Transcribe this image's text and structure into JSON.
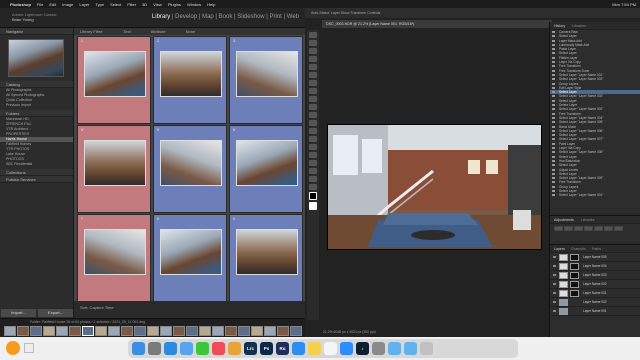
{
  "menubar": {
    "app": "Photoshop",
    "items": [
      "File",
      "Edit",
      "Image",
      "Layer",
      "Type",
      "Select",
      "Filter",
      "3D",
      "View",
      "Plugins",
      "Window",
      "Help"
    ],
    "clock": "Mon 7:54 PM"
  },
  "lightroom": {
    "identity_line1": "Adobe Lightroom Classic",
    "identity_line2": "Brian Young",
    "modules": [
      "Library",
      "Develop",
      "Map",
      "Book",
      "Slideshow",
      "Print",
      "Web"
    ],
    "active_module": "Library",
    "left_panels": {
      "navigator": "Navigator",
      "catalog": "Catalog",
      "catalog_items": [
        "All Photographs",
        "All Synced Photographs",
        "Quick Collection",
        "Previous Import"
      ],
      "folders": "Folders",
      "folder_items": [
        "Macintosh HD",
        "ZFRENCH PILL",
        "YTR Architect...",
        "PROPERTIES",
        "Harris House",
        "Fairfield Homes",
        "YTR PHOTOS",
        "Lake House",
        "PHOTOGS",
        "ABC Residential"
      ],
      "collections": "Collections",
      "publish": "Publish Services"
    },
    "buttons": [
      "Import...",
      "Export..."
    ],
    "grid_header": [
      "Library Filter:",
      "Text",
      "Attribute",
      "None"
    ],
    "cells": [
      {
        "num": "1",
        "tint": "#c37a7e"
      },
      {
        "num": "2",
        "tint": "#6d7fb8"
      },
      {
        "num": "3",
        "tint": "#6d7fb8"
      },
      {
        "num": "4",
        "tint": "#c37a7e"
      },
      {
        "num": "5",
        "tint": "#6d7fb8"
      },
      {
        "num": "6",
        "tint": "#6d7fb8"
      },
      {
        "num": "7",
        "tint": "#c37a7e"
      },
      {
        "num": "8",
        "tint": "#6d7fb8"
      },
      {
        "num": "9",
        "tint": "#6d7fb8"
      }
    ],
    "toolbar_text": "Sort: Capture Time",
    "filmstrip_info": "Folder: Fairfield House   26 of 64 photos / 1 selected / 2021_05_11 001.dng"
  },
  "photoshop": {
    "options_bar": "Auto-Select: Layer   Show Transform Controls",
    "doc_tab": "DSC_0003.HDR @ 21.2% (Layer Name 001, RGB/16*)",
    "status": "21.2%   6048 px x 4024 px (300 ppi)",
    "history_tabs": [
      "History",
      "Libraries"
    ],
    "history_rows": [
      "Camera Raw",
      "Select Layer",
      "Layer Mask Add",
      "Luminosity Mask Add",
      "Paste Layer",
      "Select Layer",
      "Flatten Layer",
      "Layer Via Copy",
      "Free Transform",
      "Free Transform Done",
      "Select Layer \"Layer Name 001\"",
      "Select Layer \"Layer Name 002\"",
      "Group Layers",
      "Edit Layer Style",
      "Select Layer",
      "Select Layer \"Layer Name 003\"",
      "Select Layer",
      "Delete Layer",
      "Select Layer \"Layer Name 002\"",
      "Free Transform",
      "Select Layer \"Layer Name 004\"",
      "Select Layer \"Layer Name 005\"",
      "Blend Mode",
      "Select Layer \"Layer Name 006\"",
      "Select Layer",
      "Select Layer \"Layer Name 007\"",
      "Paint Layer",
      "Layer Via Copy",
      "Select Layer \"Layer Name 008\"",
      "Select Layer",
      "Hue/Saturation",
      "Select Layer",
      "Adjust Levels",
      "Select Layer",
      "Select Layer \"Layer Name 009\"",
      "Free Transform",
      "Group Layers",
      "Select Layer",
      "Select Layer \"Layer Name 001\""
    ],
    "adjustments_tabs": [
      "Adjustments",
      "Libraries"
    ],
    "layers_tabs": [
      "Layers",
      "Channels",
      "Paths"
    ],
    "layers": [
      "Layer Name 005",
      "Layer Name 004",
      "Layer Name 003",
      "Layer Name 002",
      "Layer Name 001",
      "Layer Name 002",
      "Layer Name 001"
    ]
  },
  "dock": {
    "apps": [
      {
        "name": "Finder",
        "color": "#3a8de0",
        "label": ""
      },
      {
        "name": "Launchpad",
        "color": "#7a7a7a",
        "label": ""
      },
      {
        "name": "Safari",
        "color": "#2c8ae0",
        "label": ""
      },
      {
        "name": "Mail",
        "color": "#5aa3f0",
        "label": ""
      },
      {
        "name": "Messages",
        "color": "#3cc63c",
        "label": ""
      },
      {
        "name": "Music",
        "color": "#f34a5b",
        "label": ""
      },
      {
        "name": "Photos",
        "color": "#e8a33a",
        "label": ""
      },
      {
        "name": "Lightroom Classic",
        "color": "#13304f",
        "label": "Lrc"
      },
      {
        "name": "Photoshop",
        "color": "#0b2a47",
        "label": "Ps"
      },
      {
        "name": "Rush",
        "color": "#1f2d58",
        "label": "Ru"
      },
      {
        "name": "App Store",
        "color": "#2f8df0",
        "label": ""
      },
      {
        "name": "Notes",
        "color": "#f5d04a",
        "label": ""
      },
      {
        "name": "Calendar",
        "color": "#f5f5f5",
        "label": ""
      },
      {
        "name": "Zoom",
        "color": "#2d8cff",
        "label": ""
      },
      {
        "name": "Amazon Music",
        "color": "#0d1e2f",
        "label": "♪"
      },
      {
        "name": "Settings",
        "color": "#8a8a8a",
        "label": ""
      },
      {
        "name": "Folder",
        "color": "#63b2f0",
        "label": ""
      },
      {
        "name": "Downloads",
        "color": "#63b2f0",
        "label": ""
      },
      {
        "name": "Trash",
        "color": "#c0c0c0",
        "label": ""
      }
    ]
  }
}
